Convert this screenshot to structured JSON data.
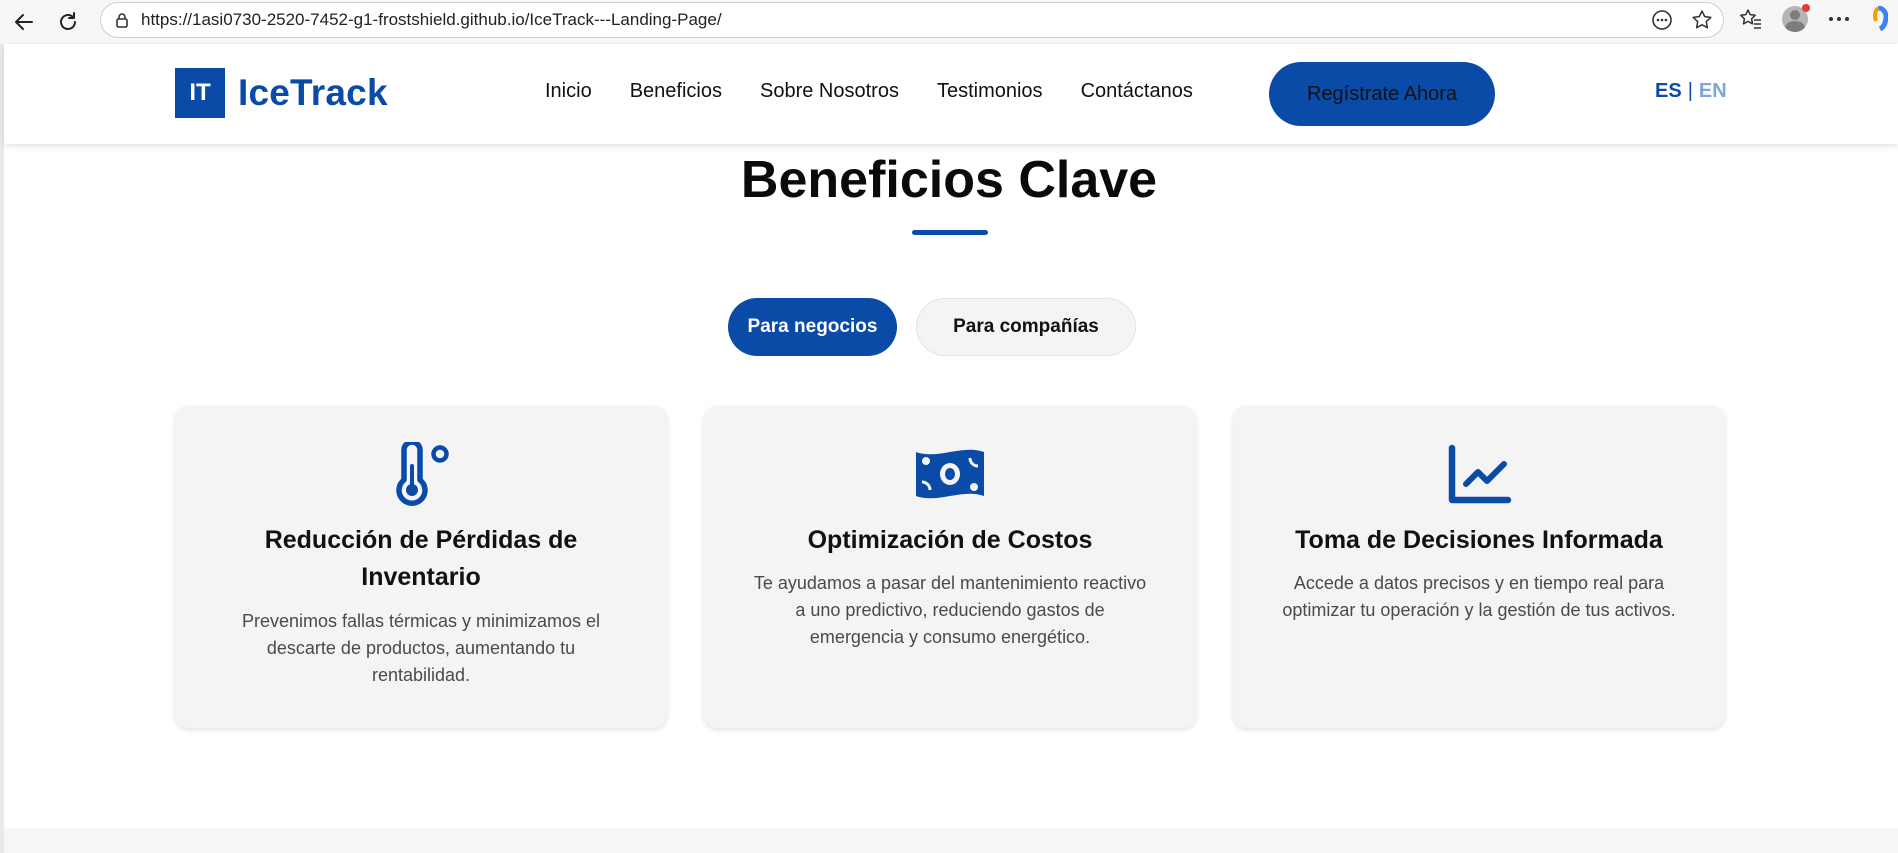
{
  "browser": {
    "url": "https://1asi0730-2520-7452-g1-frostshield.github.io/IceTrack---Landing-Page/"
  },
  "header": {
    "logo_mark": "IT",
    "logo_text": "IceTrack",
    "nav": [
      "Inicio",
      "Beneficios",
      "Sobre Nosotros",
      "Testimonios",
      "Contáctanos"
    ],
    "cta_label": "Regístrate Ahora",
    "lang_es": "ES",
    "lang_sep": "|",
    "lang_en": "EN"
  },
  "benefits": {
    "title": "Beneficios Clave",
    "tabs": [
      "Para negocios",
      "Para compañías"
    ],
    "cards": [
      {
        "icon": "thermometer-icon",
        "title": "Reducción de Pérdidas de Inventario",
        "text": "Prevenimos fallas térmicas y minimizamos el descarte de productos, aumentando tu rentabilidad."
      },
      {
        "icon": "money-bill-icon",
        "title": "Optimización de Costos",
        "text": "Te ayudamos a pasar del mantenimiento reactivo a uno predictivo, reduciendo gastos de emergencia y consumo energético."
      },
      {
        "icon": "line-chart-icon",
        "title": "Toma de Decisiones Informada",
        "text": "Accede a datos precisos y en tiempo real para optimizar tu operación y la gestión de tus activos."
      }
    ]
  },
  "colors": {
    "brand": "#0b4ba8",
    "card_bg": "#f4f4f4"
  }
}
